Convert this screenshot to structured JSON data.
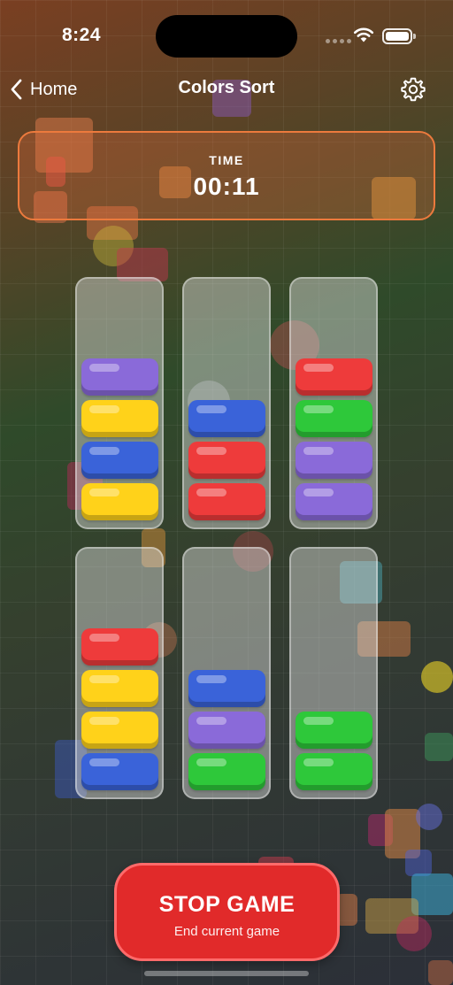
{
  "status_bar": {
    "time": "8:24"
  },
  "nav": {
    "back_label": "Home",
    "title": "Colors Sort"
  },
  "timer": {
    "label": "TIME",
    "value": "00:11"
  },
  "colors": {
    "purple": "#8a6ad9",
    "yellow": "#ffd21a",
    "blue": "#3a63d9",
    "red": "#ee3b3b",
    "green": "#2ec83a"
  },
  "tubes": [
    {
      "id": 1,
      "balls_top_to_bottom": [
        "purple",
        "yellow",
        "blue",
        "yellow"
      ]
    },
    {
      "id": 2,
      "balls_top_to_bottom": [
        "blue",
        "red",
        "red"
      ]
    },
    {
      "id": 3,
      "balls_top_to_bottom": [
        "red",
        "green",
        "purple",
        "purple"
      ]
    },
    {
      "id": 4,
      "balls_top_to_bottom": [
        "red",
        "yellow",
        "yellow",
        "blue"
      ]
    },
    {
      "id": 5,
      "balls_top_to_bottom": [
        "blue",
        "purple",
        "green"
      ]
    },
    {
      "id": 6,
      "balls_top_to_bottom": [
        "green",
        "green"
      ]
    }
  ],
  "stop_button": {
    "title": "STOP GAME",
    "subtitle": "End current game"
  }
}
